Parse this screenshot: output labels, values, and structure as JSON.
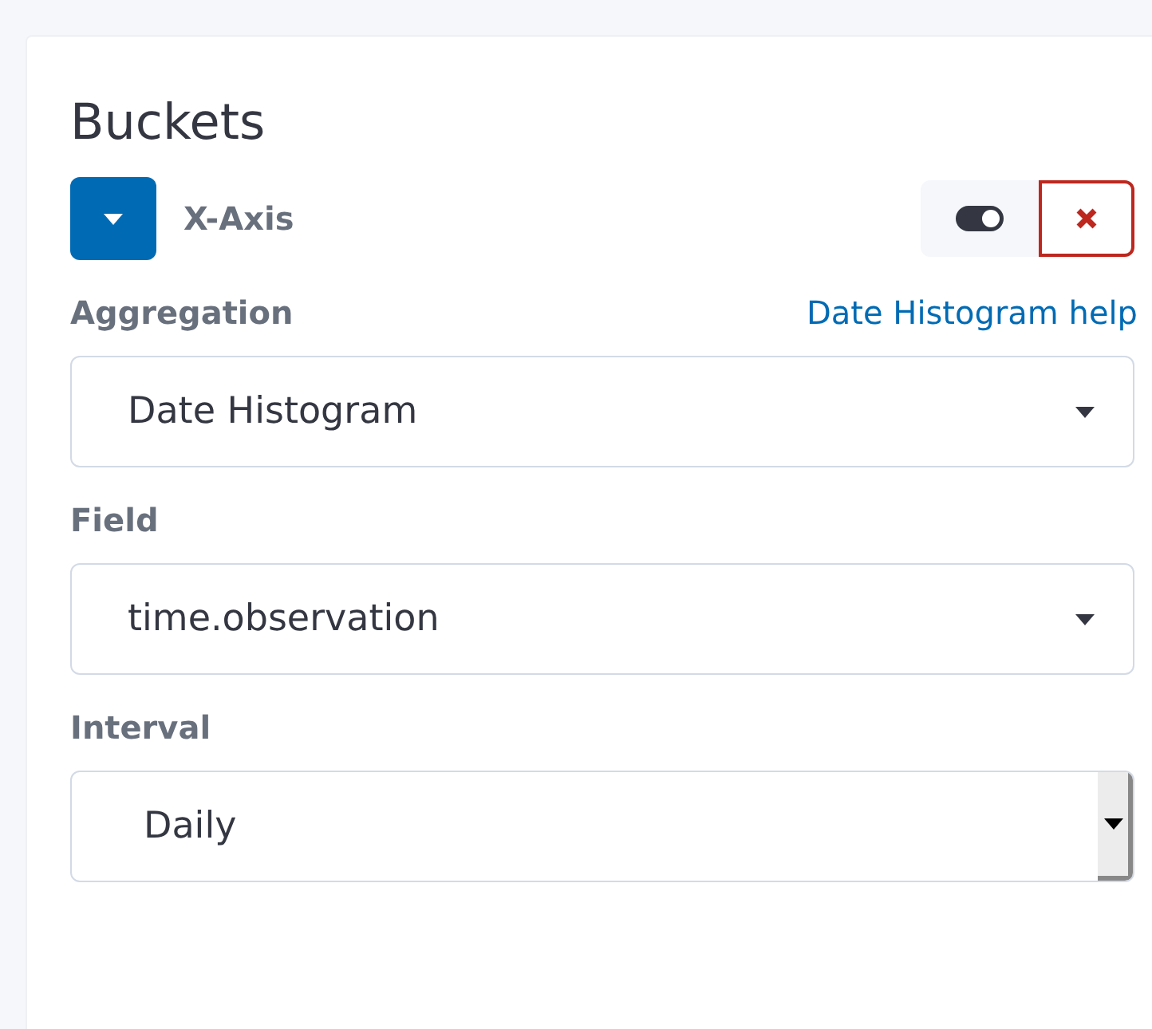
{
  "panel": {
    "title": "Buckets"
  },
  "bucket": {
    "label": "X-Axis",
    "expanded": true,
    "enabled": true
  },
  "fields": [
    {
      "label": "Aggregation",
      "help": "Date Histogram help",
      "value": "Date Histogram",
      "kind": "select"
    },
    {
      "label": "Field",
      "value": "time.observation",
      "kind": "select"
    },
    {
      "label": "Interval",
      "value": "Daily",
      "kind": "native"
    }
  ]
}
